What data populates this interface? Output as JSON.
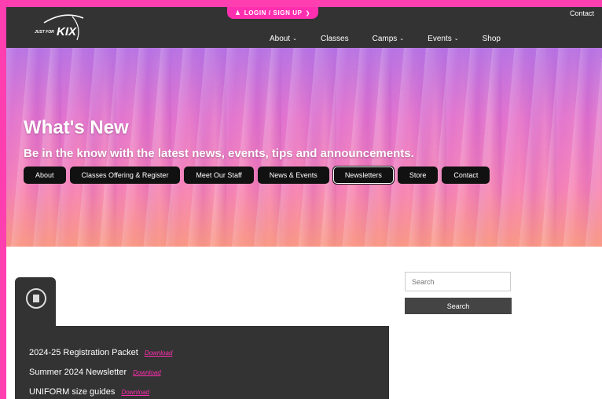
{
  "header": {
    "login_label": "LOGIN / SIGN UP",
    "contact_label": "Contact",
    "logo_text_small": "JUST FOR",
    "logo_text_big": "KIX",
    "nav": [
      {
        "label": "About",
        "has_dropdown": true
      },
      {
        "label": "Classes",
        "has_dropdown": false
      },
      {
        "label": "Camps",
        "has_dropdown": true
      },
      {
        "label": "Events",
        "has_dropdown": true
      },
      {
        "label": "Shop",
        "has_dropdown": false
      }
    ]
  },
  "hero": {
    "title": "What's New",
    "subtitle": "Be in the know with the latest news, events, tips and announcements.",
    "tabs": [
      {
        "label": "About"
      },
      {
        "label": "Classes Offering & Register"
      },
      {
        "label": "Meet Our Staff"
      },
      {
        "label": "News & Events"
      },
      {
        "label": "Newsletters",
        "active": true
      },
      {
        "label": "Store"
      },
      {
        "label": "Contact"
      }
    ]
  },
  "documents": {
    "download_label": "Download",
    "items": [
      {
        "name": "2024-25 Registration Packet"
      },
      {
        "name": "Summer 2024 Newsletter"
      },
      {
        "name": "UNIFORM size guides"
      }
    ]
  },
  "search": {
    "placeholder": "Search",
    "button_label": "Search"
  },
  "colors": {
    "frame": "#ff3fb0",
    "nav_bg": "#333333",
    "accent": "#ff2fb0"
  }
}
